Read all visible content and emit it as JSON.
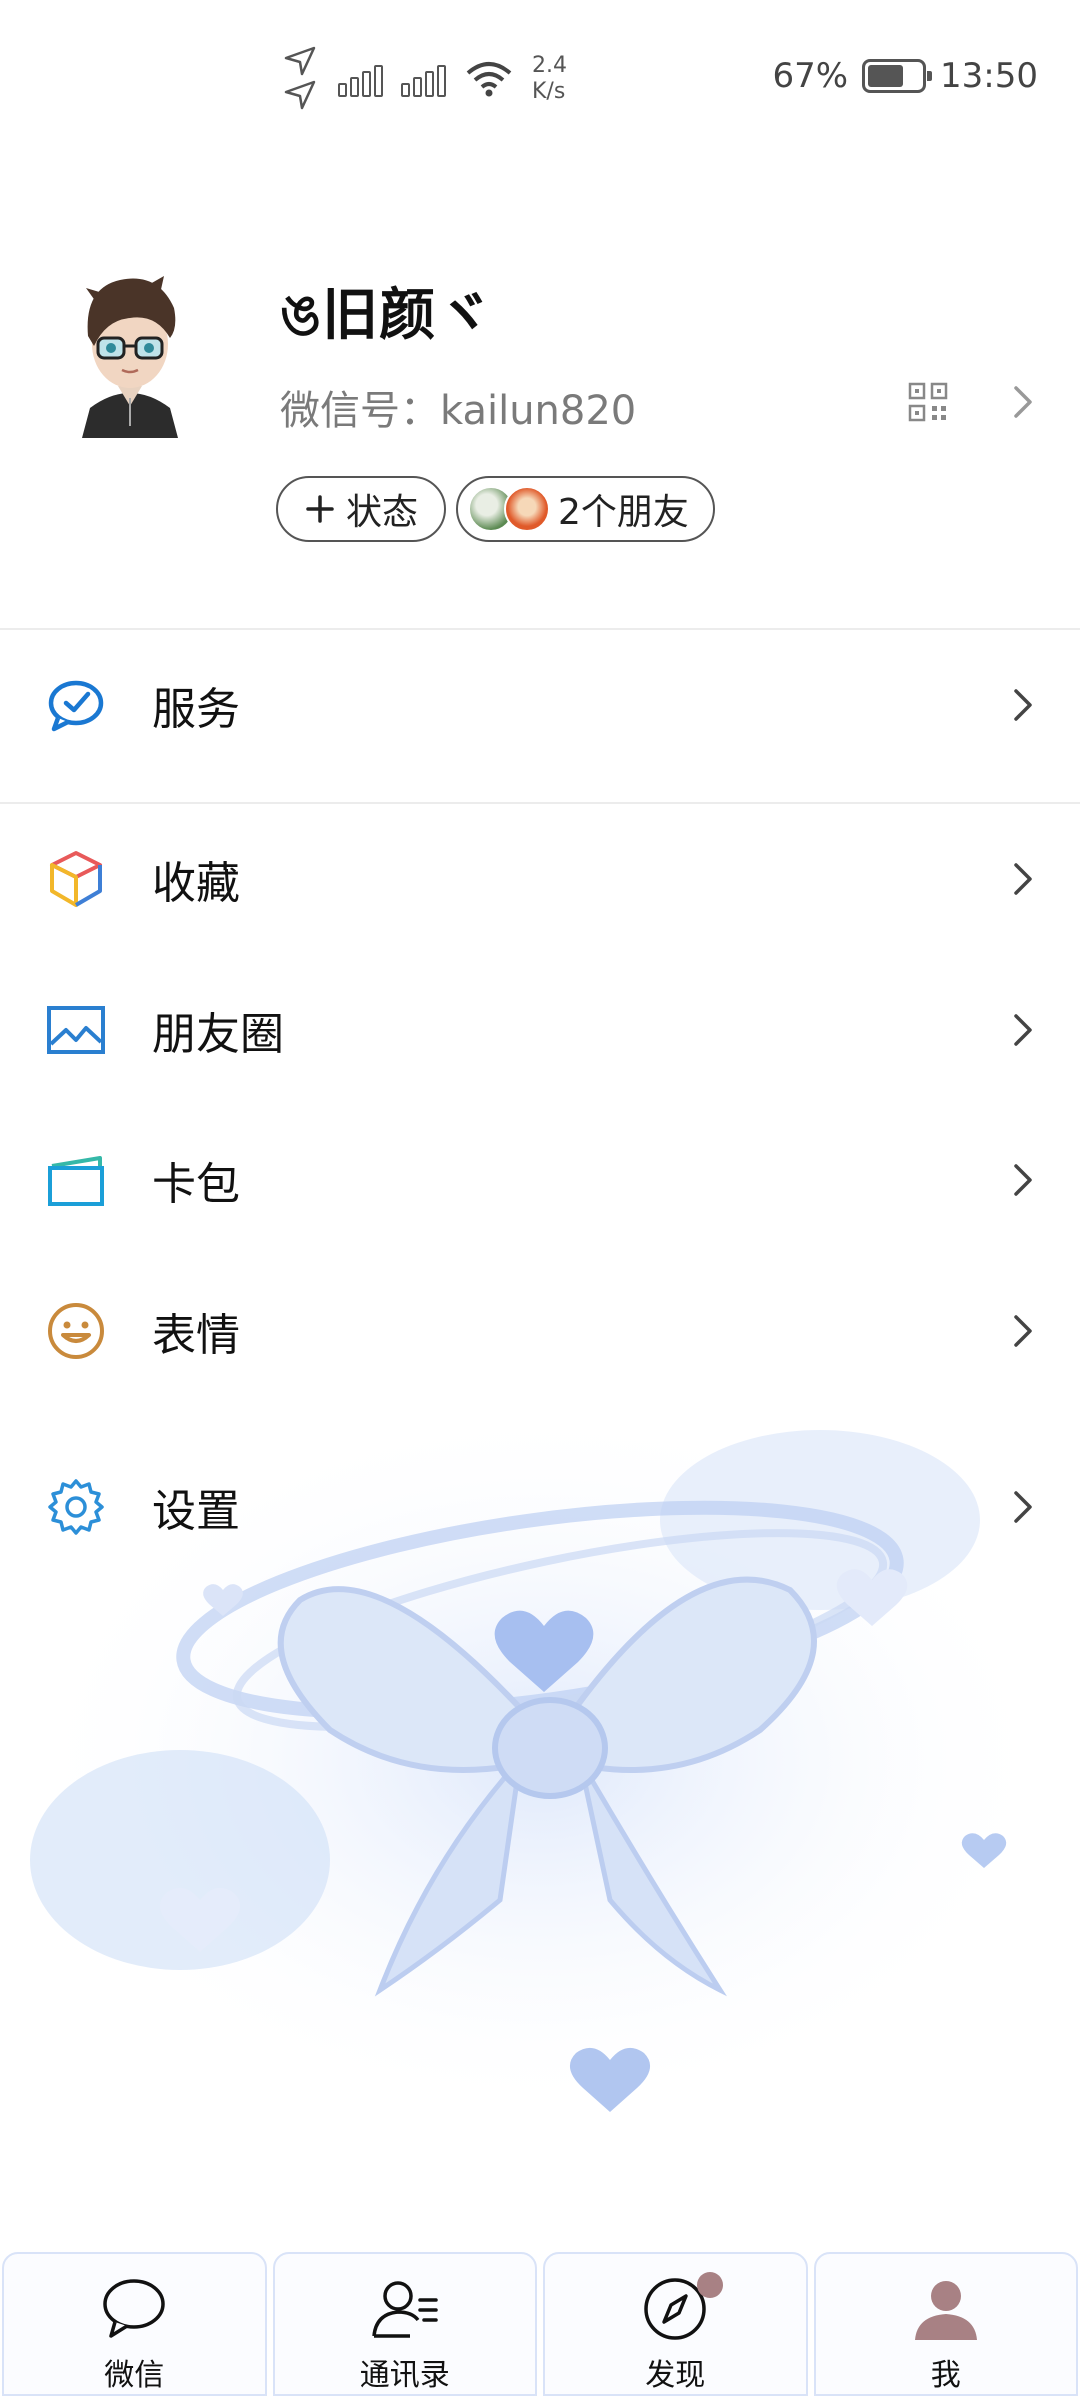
{
  "status_bar": {
    "speed_value": "2.4",
    "speed_unit": "K/s",
    "battery_percent": "67%",
    "battery_level": 0.67,
    "time": "13:50"
  },
  "profile": {
    "nickname": "ঙ旧颜ヾ",
    "wechat_id": "微信号：kailun820",
    "status_button": "状态",
    "friends_button": "2个朋友"
  },
  "menu": {
    "services": "服务",
    "favorites": "收藏",
    "moments": "朋友圈",
    "cards": "卡包",
    "stickers": "表情",
    "settings": "设置"
  },
  "tabbar": {
    "chats": "微信",
    "contacts": "通讯录",
    "discover": "发现",
    "me": "我"
  },
  "colors": {
    "services_icon": "#1a78d2",
    "moments_icon": "#2a7fd0",
    "cards_icon": "#1b9fd8",
    "stickers_icon": "#c98a3c",
    "settings_icon": "#2c8fd8",
    "badge": "#a88184",
    "me_icon": "#a88184"
  }
}
